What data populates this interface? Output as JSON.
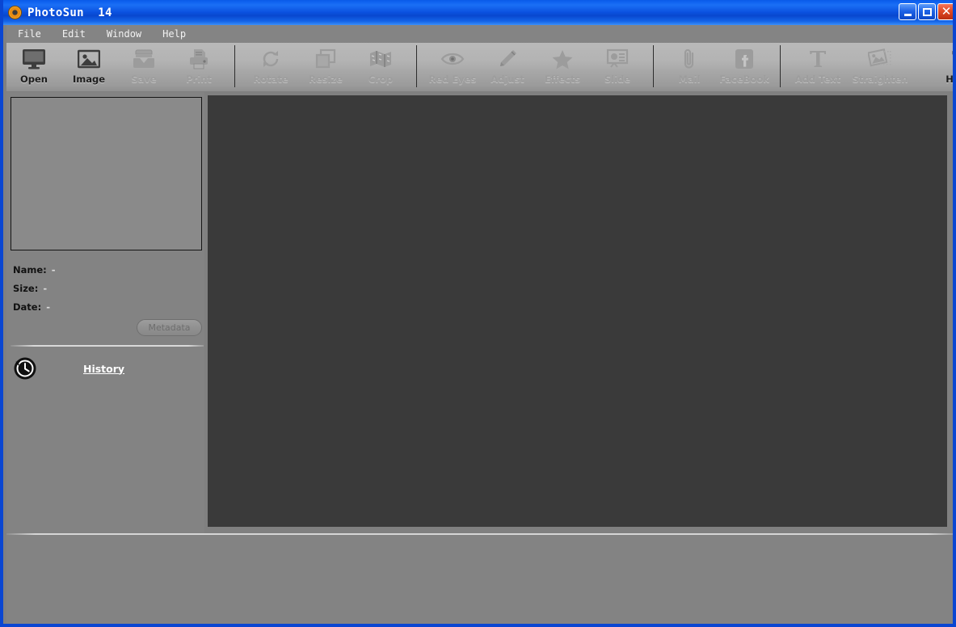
{
  "window": {
    "title": "PhotoSun  14",
    "app_icon": "photosun-orb-icon",
    "controls": {
      "minimize": "minimize-icon",
      "maximize": "maximize-icon",
      "close": "close-icon"
    }
  },
  "menubar": {
    "items": [
      {
        "label": "File"
      },
      {
        "label": "Edit"
      },
      {
        "label": "Window"
      },
      {
        "label": "Help"
      }
    ]
  },
  "toolbar": {
    "groups": [
      {
        "buttons": [
          {
            "label": "Open",
            "icon": "monitor-icon",
            "enabled": true
          },
          {
            "label": "Image",
            "icon": "picture-icon",
            "enabled": true
          },
          {
            "label": "Save",
            "icon": "save-tray-icon",
            "enabled": false
          },
          {
            "label": "Print",
            "icon": "printer-icon",
            "enabled": false
          }
        ]
      },
      {
        "buttons": [
          {
            "label": "Rotate",
            "icon": "rotate-icon",
            "enabled": false
          },
          {
            "label": "Resize",
            "icon": "resize-icon",
            "enabled": false
          },
          {
            "label": "Crop",
            "icon": "crop-map-icon",
            "enabled": false
          }
        ]
      },
      {
        "buttons": [
          {
            "label": "Red Eyes",
            "icon": "eye-icon",
            "enabled": false
          },
          {
            "label": "Adjust",
            "icon": "pencil-icon",
            "enabled": false
          },
          {
            "label": "Effects",
            "icon": "star-icon",
            "enabled": false
          },
          {
            "label": "Slide",
            "icon": "slideshow-icon",
            "enabled": false
          }
        ]
      },
      {
        "buttons": [
          {
            "label": "Mail",
            "icon": "paperclip-icon",
            "enabled": false
          },
          {
            "label": "FaceBook",
            "icon": "facebook-icon",
            "enabled": false
          }
        ]
      },
      {
        "buttons": [
          {
            "label": "Add Text",
            "icon": "text-t-icon",
            "enabled": false
          },
          {
            "label": "Straighten",
            "icon": "straighten-icon",
            "enabled": false
          }
        ]
      },
      {
        "buttons": [
          {
            "label": "Help",
            "icon": "question-mark-icon",
            "enabled": true
          }
        ]
      }
    ]
  },
  "sidebar": {
    "thumbnail_placeholder": "",
    "info": {
      "name_label": "Name:",
      "name_value": "-",
      "size_label": "Size:",
      "size_value": "-",
      "date_label": "Date:",
      "date_value": "-"
    },
    "metadata_button": "Metadata",
    "history": {
      "icon": "history-clock-icon",
      "label": "History"
    }
  },
  "canvas": {
    "content": ""
  },
  "colors": {
    "titlebar_blue": "#0a46d2",
    "window_border": "#0a46d2",
    "panel_grey": "#838383",
    "toolbar_grey": "#b3b3b3",
    "canvas_dark": "#3a3a3a",
    "enabled_label": "#1c1c1c",
    "disabled_label": "#9d9d9d",
    "close_red": "#d03a14"
  }
}
